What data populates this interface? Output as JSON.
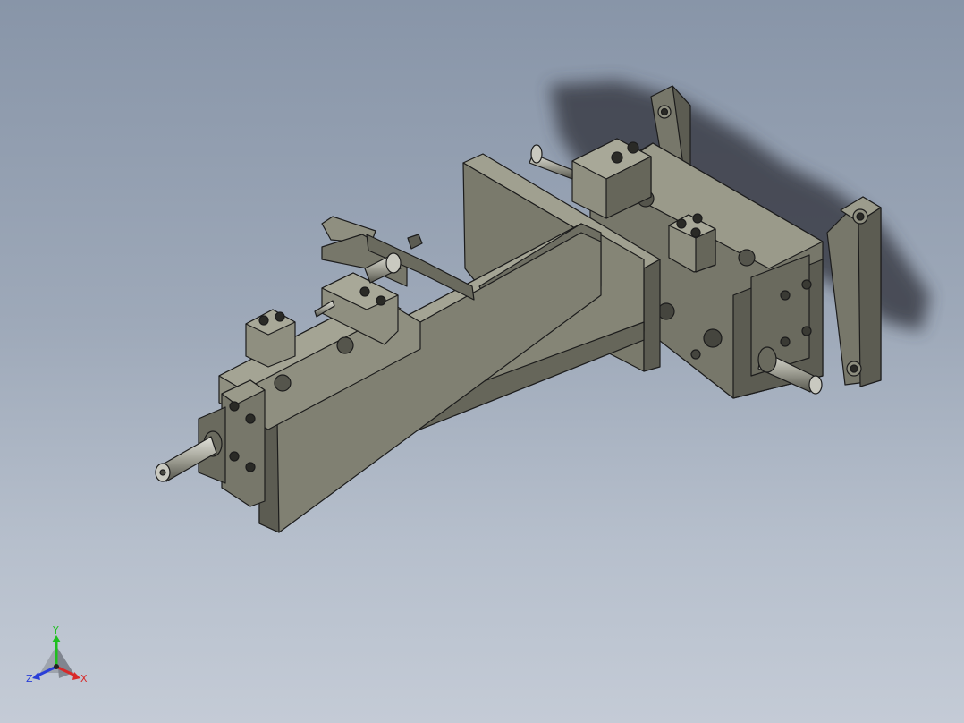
{
  "viewport": {
    "background_top": "#8895a8",
    "background_bottom": "#c4cbd6",
    "part_face_light": "#8f8f80",
    "part_face_mid": "#77776a",
    "part_face_dark": "#5c5c52",
    "edge_color": "#1c1c1c",
    "shadow_color": "#3a3e46"
  },
  "triad": {
    "y_label": "Y",
    "z_label": "Z",
    "x_label": "X",
    "y_color": "#1fbf1f",
    "z_color": "#2a3fd8",
    "x_color": "#d82a2a"
  }
}
